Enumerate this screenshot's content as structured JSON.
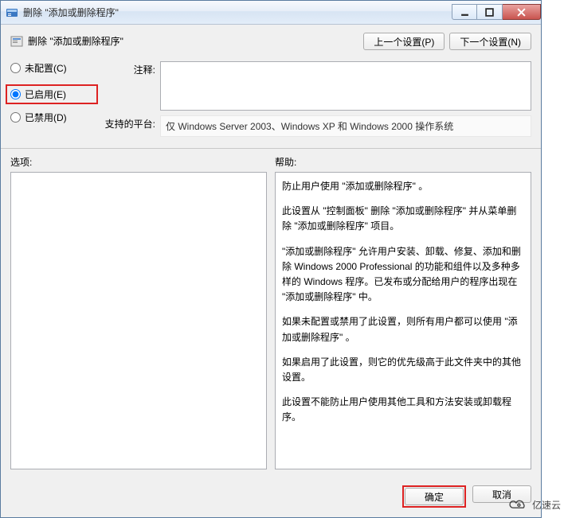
{
  "window": {
    "title": "删除 \"添加或删除程序\""
  },
  "header": {
    "subtitle": "删除 \"添加或删除程序\"",
    "prev_btn": "上一个设置(P)",
    "next_btn": "下一个设置(N)"
  },
  "radios": {
    "not_configured": "未配置(C)",
    "enabled": "已启用(E)",
    "disabled": "已禁用(D)",
    "selected": "enabled"
  },
  "labels": {
    "comment": "注释:",
    "platform": "支持的平台:",
    "options": "选项:",
    "help": "帮助:"
  },
  "platform_value": "仅 Windows Server 2003、Windows XP 和 Windows 2000 操作系统",
  "help_paragraphs": [
    "防止用户使用 \"添加或删除程序\" 。",
    "此设置从 \"控制面板\" 删除 \"添加或删除程序\" 并从菜单删除 \"添加或删除程序\" 项目。",
    "\"添加或删除程序\" 允许用户安装、卸载、修复、添加和删除 Windows 2000 Professional 的功能和组件以及多种多样的 Windows 程序。已发布或分配给用户的程序出现在 \"添加或删除程序\" 中。",
    "如果未配置或禁用了此设置，则所有用户都可以使用 \"添加或删除程序\" 。",
    "如果启用了此设置，则它的优先级高于此文件夹中的其他设置。",
    "此设置不能防止用户使用其他工具和方法安装或卸载程序。"
  ],
  "footer": {
    "ok": "确定",
    "cancel": "取消"
  },
  "watermark": "亿速云"
}
